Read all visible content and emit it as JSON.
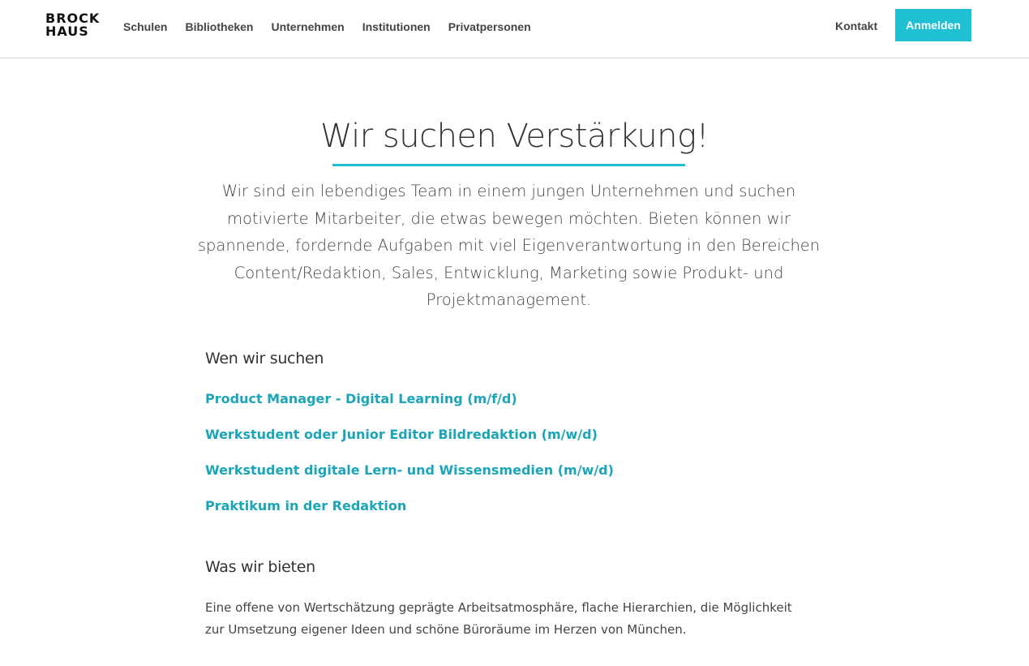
{
  "header": {
    "logo_line1": "BROCK",
    "logo_line2": "HAUS",
    "nav": [
      {
        "label": "Schulen"
      },
      {
        "label": "Bibliotheken"
      },
      {
        "label": "Unternehmen"
      },
      {
        "label": "Institutionen"
      },
      {
        "label": "Privatpersonen"
      }
    ],
    "contact_label": "Kontakt",
    "login_label": "Anmelden"
  },
  "main": {
    "title": "Wir suchen Verstärkung!",
    "intro": "Wir sind ein lebendiges Team in einem jungen Unternehmen und suchen motivierte Mitarbeiter, die etwas bewegen möchten. Bieten können wir spannende, fordernde Aufgaben mit viel Eigenverantwortung in den Bereichen Content/Redaktion, Sales, Entwicklung, Marketing sowie Produkt- und Projektmanagement.",
    "jobs_heading": "Wen wir suchen",
    "jobs": [
      {
        "title": "Product Manager - Digital Learning (m/f/d)"
      },
      {
        "title": "Werkstudent oder Junior Editor Bildredaktion (m/w/d)"
      },
      {
        "title": "Werkstudent digitale Lern- und Wissensmedien (m/w/d)"
      },
      {
        "title": "Praktikum in der Redaktion"
      }
    ],
    "offer_heading": "Was wir bieten",
    "offer_text": "Eine offene von Wertschätzung geprägte Arbeitsatmosphäre, flache Hierarchien, die Möglichkeit zur Umsetzung eigener Ideen und schöne Büroräume im Herzen von München."
  },
  "colors": {
    "accent": "#1fbfd4",
    "link": "#1aa5b8",
    "text": "#333333"
  }
}
